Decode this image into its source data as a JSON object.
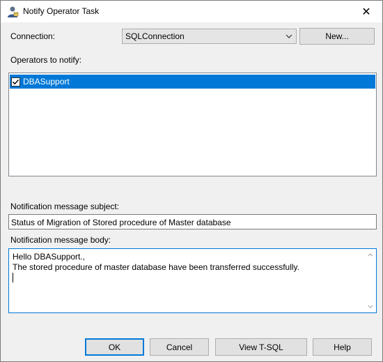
{
  "window": {
    "title": "Notify Operator Task",
    "close_glyph": "✕",
    "icon": "notify-operator-icon"
  },
  "connection": {
    "label": "Connection:",
    "value": "SQLConnection",
    "new_button": "New..."
  },
  "operators": {
    "label": "Operators to notify:",
    "items": [
      {
        "name": "DBASupport",
        "checked": true,
        "selected": true
      }
    ]
  },
  "subject": {
    "label": "Notification message subject:",
    "value": "Status of Migration of Stored procedure of Master database"
  },
  "body": {
    "label": "Notification message body:",
    "lines": [
      "Hello DBASupport.,",
      "The stored procedure of master database have been transferred successfully."
    ]
  },
  "buttons": {
    "ok": "OK",
    "cancel": "Cancel",
    "view_tsql": "View T-SQL",
    "help": "Help"
  },
  "colors": {
    "selection": "#0078d7",
    "dialog_bg": "#f0f0f0",
    "default_button_border": "#0078d7"
  }
}
